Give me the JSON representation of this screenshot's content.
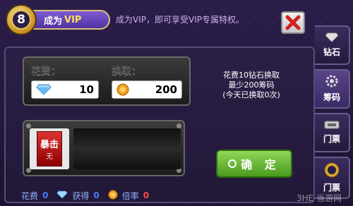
{
  "header": {
    "vip_level": "8",
    "ribbon_prefix": "成为",
    "ribbon_vip": "VIP",
    "promo_text": "成为VIP，即可享受VIP专属特权。"
  },
  "exchange": {
    "cost_label": "花费：",
    "get_label": "换取：",
    "cost_value": "10",
    "get_value": "200"
  },
  "info": {
    "line1": "花费10钻石换取",
    "line2": "最少200筹码",
    "line3": "(今天已换取0次)"
  },
  "slot": {
    "tile_title": "暴击",
    "tile_sub": "无"
  },
  "confirm_label": "确 定",
  "bottom": {
    "cost_label": "花费",
    "cost_value": "0",
    "get_label": "获得",
    "get_value": "0",
    "rate_label": "倍率",
    "rate_value": "0"
  },
  "tabs": [
    {
      "label": "钻石",
      "icon": "diamond-icon"
    },
    {
      "label": "筹码",
      "icon": "gear-icon"
    },
    {
      "label": "门票",
      "icon": "ticket-icon"
    },
    {
      "label": "门票",
      "icon": "vip-icon"
    }
  ],
  "watermark": "3HE 当游网",
  "colors": {
    "accent_green": "#6abf3a",
    "close_red": "#d42020",
    "gold": "#e5c25a"
  }
}
